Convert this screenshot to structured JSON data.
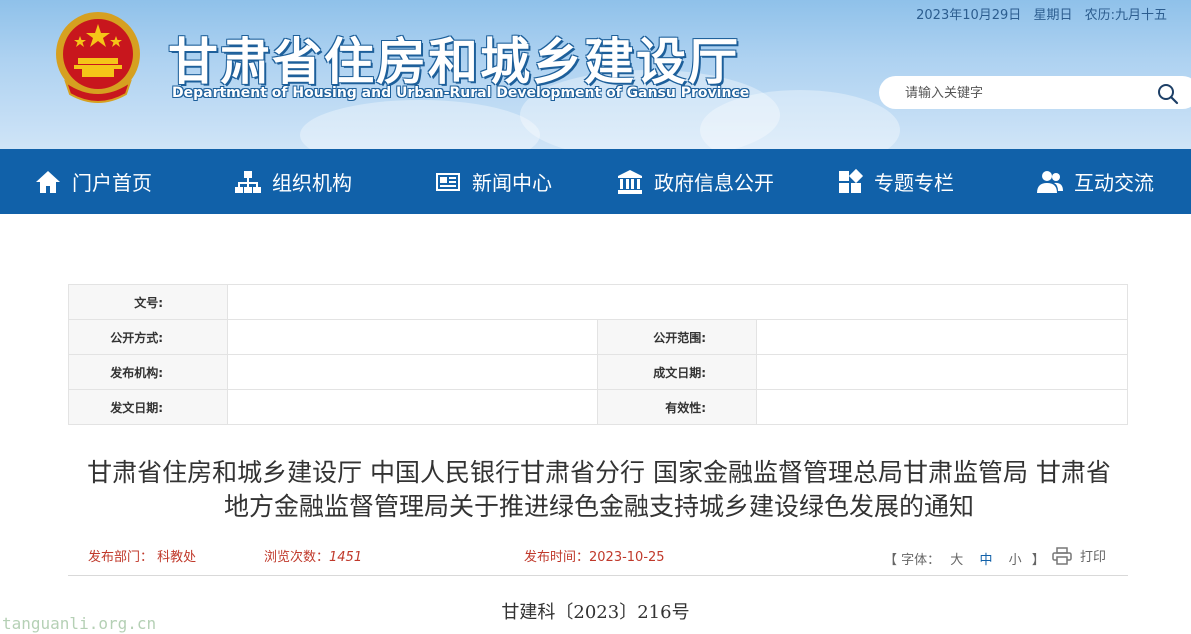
{
  "header": {
    "date": "2023年10月29日",
    "weekday": "星期日",
    "lunar": "农历:九月十五",
    "title": "甘肃省住房和城乡建设厅",
    "subtitle": "Department of Housing and Urban-Rural Development of Gansu Province",
    "search_placeholder": "请输入关键字"
  },
  "nav": {
    "items": [
      {
        "label": "门户首页",
        "icon": "home-icon"
      },
      {
        "label": "组织机构",
        "icon": "org-chart-icon"
      },
      {
        "label": "新闻中心",
        "icon": "news-icon"
      },
      {
        "label": "政府信息公开",
        "icon": "government-building-icon"
      },
      {
        "label": "专题专栏",
        "icon": "grid-tiles-icon"
      },
      {
        "label": "互动交流",
        "icon": "users-icon"
      }
    ]
  },
  "info_table": {
    "doc_number_label": "文号:",
    "disclosure_method_label": "公开方式:",
    "disclosure_scope_label": "公开范围:",
    "issuer_label": "发布机构:",
    "written_date_label": "成文日期:",
    "issue_date_label": "发文日期:",
    "validity_label": "有效性:"
  },
  "article": {
    "title": "甘肃省住房和城乡建设厅 中国人民银行甘肃省分行 国家金融监督管理总局甘肃监管局 甘肃省地方金融监督管理局关于推进绿色金融支持城乡建设绿色发展的通知",
    "dept_label": "发布部门：",
    "dept": "科教处",
    "views_label": "浏览次数：",
    "views": "1451",
    "publish_label": "发布时间：",
    "publish_date": "2023-10-25",
    "font_label": "【 字体：",
    "font_large": "大",
    "font_medium": "中",
    "font_small": "小",
    "font_close": "】",
    "print_label": "打印",
    "doc_no": "甘建科〔2023〕216号"
  },
  "watermark": "tanguanli.org.cn",
  "colors": {
    "nav_bg": "#1161a9",
    "accent_red": "#c0392b",
    "header_sky": "#aed2f1"
  }
}
